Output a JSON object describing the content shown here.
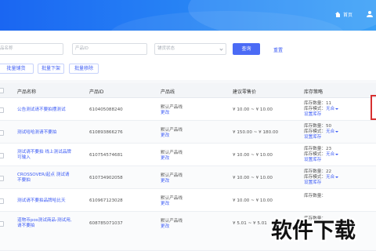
{
  "header": {
    "home_label": "首页"
  },
  "filters": {
    "name_placeholder": "品名称",
    "id_placeholder": "产品ID",
    "status_placeholder": "铺货状态",
    "query_label": "查询",
    "reset_label": "重置"
  },
  "actions": {
    "batch_distribute": "批量铺货",
    "batch_offshelf": "批量下架",
    "batch_remove": "批量移除"
  },
  "table": {
    "columns": [
      "产品名称",
      "产品ID",
      "产品线",
      "建议零售价",
      "库存策略"
    ],
    "rows": [
      {
        "name": "公告测试请不要拍摆测试",
        "id": "610405088240",
        "line": "默认产品线",
        "edit": "更改",
        "price": "¥ 10.00 ~ ¥ 10.00",
        "stock": "库存数量：11",
        "mode_label": "库存模式：",
        "mode_value": "无合",
        "set_stock": "设置库存"
      },
      {
        "name": "测试哈哈测请不要拍",
        "id": "610893866276",
        "line": "默认产品线",
        "edit": "更改",
        "price": "¥ 150.00 ~ ¥ 180.00",
        "stock": "库存数量：50",
        "mode_label": "库存模式：",
        "mode_value": "无合",
        "set_stock": "设置库存"
      },
      {
        "name": "测试请不要拍 线上测试品牌可输入",
        "id": "610754574681",
        "line": "默认产品线",
        "edit": "更改",
        "price": "¥ 10.00 ~ ¥ 10.00",
        "stock": "库存数量：23",
        "mode_label": "库存模式：",
        "mode_value": "无合",
        "set_stock": "设置库存"
      },
      {
        "name": "CROSSOVER/起点 测试请不要拍",
        "id": "610734902058",
        "line": "默认产品线",
        "edit": "更改",
        "price": "¥ 10.00 ~ ¥ 10.00",
        "stock": "库存数量：22",
        "mode_label": "库存模式：",
        "mode_value": "无合",
        "set_stock": "设置库存"
      },
      {
        "name": "测试请不要拍品牌哈比天",
        "id": "610967123028",
        "line": "默认产品线",
        "edit": "更改",
        "price": "¥ 10.00 ~ ¥ 10.00",
        "stock": "库存数量：",
        "mode_label": "",
        "mode_value": "",
        "set_stock": ""
      },
      {
        "name": "道物币pos测试商品-测试用,请不要拍",
        "id": "608785071037",
        "line": "默认产品线",
        "edit": "更改",
        "price": "¥ 5.01 ~ ¥ 5.01",
        "stock": "库存数量：",
        "mode_label": "",
        "mode_value": "",
        "set_stock": ""
      }
    ]
  },
  "watermark": "软件下载",
  "colors": {
    "primary": "#3d5cf5",
    "header_start": "#1a66f2",
    "header_end": "#3aa0f7",
    "highlight": "#d73030"
  }
}
